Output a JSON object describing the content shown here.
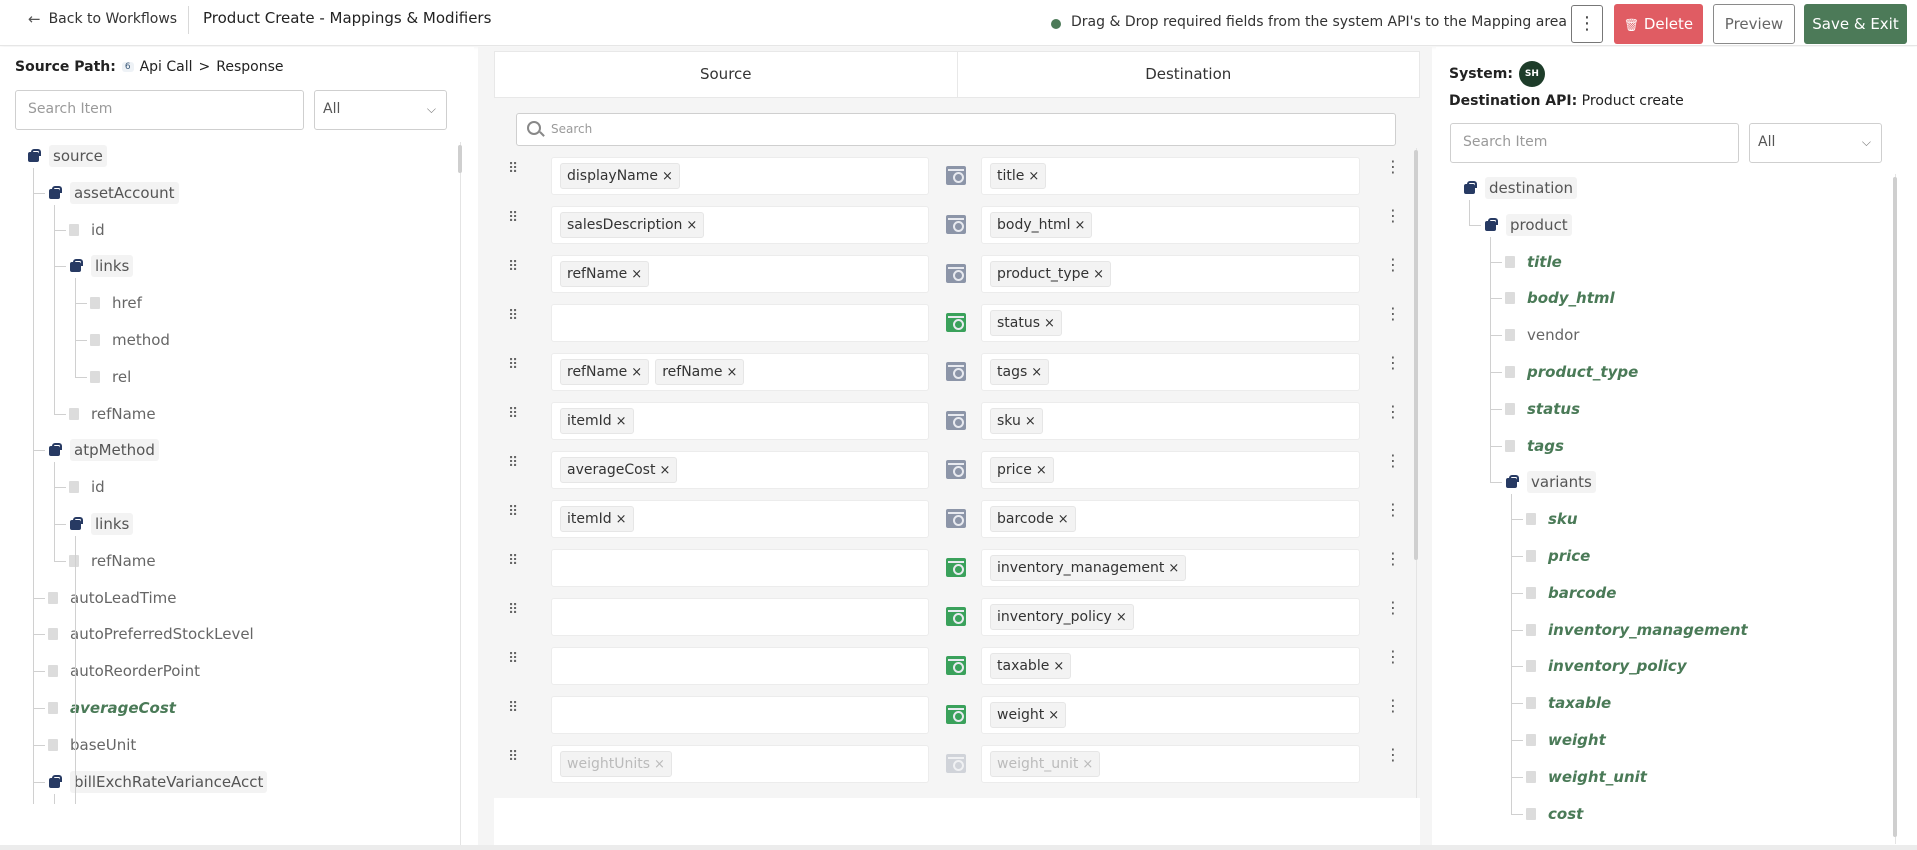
{
  "header": {
    "back_label": "Back to Workflows",
    "title": "Product Create - Mappings & Modifiers",
    "hint": "Drag & Drop required fields from the system API's to the Mapping area",
    "delete_label": "Delete",
    "preview_label": "Preview",
    "save_label": "Save & Exit"
  },
  "left": {
    "source_path_label": "Source Path:",
    "source_path_count": "6",
    "source_path_api": "Api Call",
    "source_path_sep": ">",
    "source_path_response": "Response",
    "search_placeholder": "Search Item",
    "filter_value": "All",
    "tree": [
      {
        "label": "source",
        "type": "object",
        "depth": 0
      },
      {
        "label": "assetAccount",
        "type": "object",
        "depth": 1
      },
      {
        "label": "id",
        "type": "leaf",
        "depth": 2
      },
      {
        "label": "links",
        "type": "object",
        "depth": 2
      },
      {
        "label": "href",
        "type": "leaf",
        "depth": 3
      },
      {
        "label": "method",
        "type": "leaf",
        "depth": 3
      },
      {
        "label": "rel",
        "type": "leaf",
        "depth": 3
      },
      {
        "label": "refName",
        "type": "leaf",
        "depth": 2
      },
      {
        "label": "atpMethod",
        "type": "object",
        "depth": 1
      },
      {
        "label": "id",
        "type": "leaf",
        "depth": 2
      },
      {
        "label": "links",
        "type": "object",
        "depth": 2
      },
      {
        "label": "refName",
        "type": "leaf",
        "depth": 2
      },
      {
        "label": "autoLeadTime",
        "type": "leaf",
        "depth": 1
      },
      {
        "label": "autoPreferredStockLevel",
        "type": "leaf",
        "depth": 1
      },
      {
        "label": "autoReorderPoint",
        "type": "leaf",
        "depth": 1
      },
      {
        "label": "averageCost",
        "type": "mapped",
        "depth": 1
      },
      {
        "label": "baseUnit",
        "type": "leaf",
        "depth": 1
      },
      {
        "label": "billExchRateVarianceAcct",
        "type": "object",
        "depth": 1
      }
    ]
  },
  "middle": {
    "tab_source": "Source",
    "tab_destination": "Destination",
    "search_placeholder": "Search",
    "rows": [
      {
        "source": [
          "displayName"
        ],
        "destination": "title",
        "modifier": "gray"
      },
      {
        "source": [
          "salesDescription"
        ],
        "destination": "body_html",
        "modifier": "gray"
      },
      {
        "source": [
          "refName"
        ],
        "destination": "product_type",
        "modifier": "gray"
      },
      {
        "source": [],
        "destination": "status",
        "modifier": "green"
      },
      {
        "source": [
          "refName",
          "refName"
        ],
        "destination": "tags",
        "modifier": "gray"
      },
      {
        "source": [
          "itemId"
        ],
        "destination": "sku",
        "modifier": "gray"
      },
      {
        "source": [
          "averageCost"
        ],
        "destination": "price",
        "modifier": "gray"
      },
      {
        "source": [
          "itemId"
        ],
        "destination": "barcode",
        "modifier": "gray"
      },
      {
        "source": [],
        "destination": "inventory_management",
        "modifier": "green"
      },
      {
        "source": [],
        "destination": "inventory_policy",
        "modifier": "green"
      },
      {
        "source": [],
        "destination": "taxable",
        "modifier": "green"
      },
      {
        "source": [],
        "destination": "weight",
        "modifier": "green"
      },
      {
        "source": [
          "weightUnits"
        ],
        "destination": "weight_unit",
        "modifier": "gray",
        "faded": true
      }
    ]
  },
  "right": {
    "system_label": "System:",
    "system_avatar": "SH",
    "dest_api_label": "Destination API:",
    "dest_api_value": "Product create",
    "search_placeholder": "Search Item",
    "filter_value": "All",
    "tree": [
      {
        "label": "destination",
        "type": "object",
        "depth": 0
      },
      {
        "label": "product",
        "type": "object",
        "depth": 1
      },
      {
        "label": "title",
        "type": "mapped",
        "depth": 2
      },
      {
        "label": "body_html",
        "type": "mapped",
        "depth": 2
      },
      {
        "label": "vendor",
        "type": "leaf",
        "depth": 2
      },
      {
        "label": "product_type",
        "type": "mapped",
        "depth": 2
      },
      {
        "label": "status",
        "type": "mapped",
        "depth": 2
      },
      {
        "label": "tags",
        "type": "mapped",
        "depth": 2
      },
      {
        "label": "variants",
        "type": "object",
        "depth": 2
      },
      {
        "label": "sku",
        "type": "mapped",
        "depth": 3
      },
      {
        "label": "price",
        "type": "mapped",
        "depth": 3
      },
      {
        "label": "barcode",
        "type": "mapped",
        "depth": 3
      },
      {
        "label": "inventory_management",
        "type": "mapped",
        "depth": 3
      },
      {
        "label": "inventory_policy",
        "type": "mapped",
        "depth": 3
      },
      {
        "label": "taxable",
        "type": "mapped",
        "depth": 3
      },
      {
        "label": "weight",
        "type": "mapped",
        "depth": 3
      },
      {
        "label": "weight_unit",
        "type": "mapped",
        "depth": 3
      },
      {
        "label": "cost",
        "type": "mapped",
        "depth": 3
      }
    ]
  },
  "colors": {
    "accent_green": "#4c7a58",
    "delete_red": "#e05c63",
    "modifier_green": "#3aa15b",
    "modifier_gray": "#8c95a8",
    "object_icon": "#273a63"
  }
}
